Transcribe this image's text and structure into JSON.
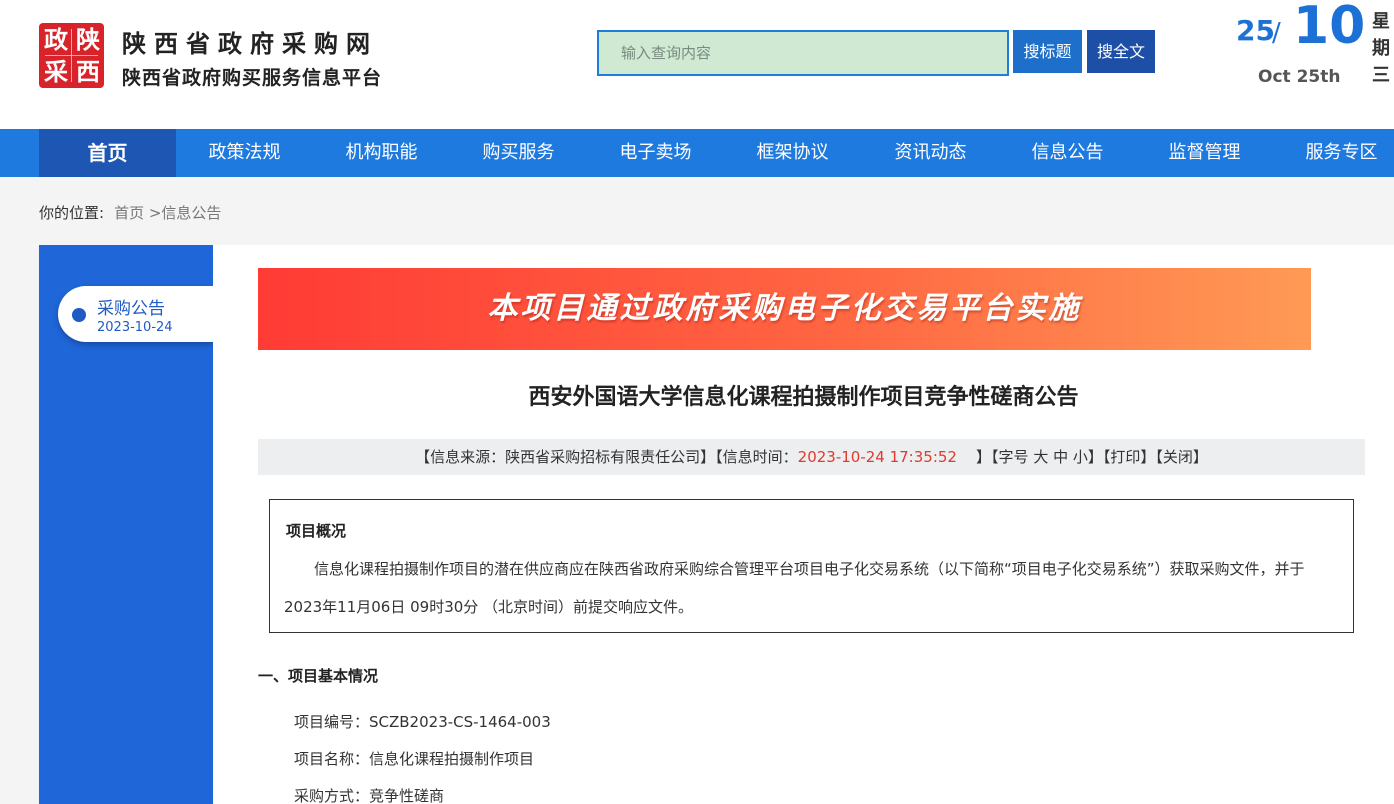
{
  "header": {
    "logo_chars": [
      "政",
      "陕",
      "采",
      "西"
    ],
    "title": "陕西省政府采购网",
    "subtitle": "陕西省政府购买服务信息平台",
    "search_placeholder": "输入查询内容",
    "search_title_label": "搜标题",
    "search_full_label": "搜全文",
    "date_day": "25",
    "date_sep": "/",
    "date_month": "10",
    "date_en": "Oct 25th",
    "date_week": "星期三"
  },
  "nav": {
    "items": [
      "首页",
      "政策法规",
      "机构职能",
      "购买服务",
      "电子卖场",
      "框架协议",
      "资讯动态",
      "信息公告",
      "监督管理",
      "服务专区"
    ]
  },
  "breadcrumb": {
    "label": "你的位置:",
    "path": "首页 >信息公告"
  },
  "sidebar": {
    "tab_label": "采购公告",
    "tab_date": "2023-10-24"
  },
  "article": {
    "banner": "本项目通过政府采购电子化交易平台实施",
    "title": "西安外国语大学信息化课程拍摄制作项目竞争性磋商公告",
    "meta_source": "【信息来源：陕西省采购招标有限责任公司】【信息时间：",
    "meta_time": "2023-10-24 17:35:52",
    "meta_rest": "】【字号 大 中 小】【打印】【关闭】",
    "summary_head": "项目概况",
    "summary_text": "信息化课程拍摄制作项目的潜在供应商应在陕西省政府采购综合管理平台项目电子化交易系统（以下简称“项目电子化交易系统”）获取采购文件，并于 2023年11月06日 09时30分 （北京时间）前提交响应文件。",
    "section_head": "一、项目基本情况",
    "info_rows": [
      "项目编号：SCZB2023-CS-1464-003",
      "项目名称：信息化课程拍摄制作项目",
      "采购方式：竞争性磋商"
    ]
  },
  "colors": {
    "nav_bg": "#1f7ae0",
    "nav_active": "#1e56b3",
    "accent_blue": "#1d71d6",
    "logo_red": "#d9232a",
    "time_red": "#e03a2c"
  }
}
